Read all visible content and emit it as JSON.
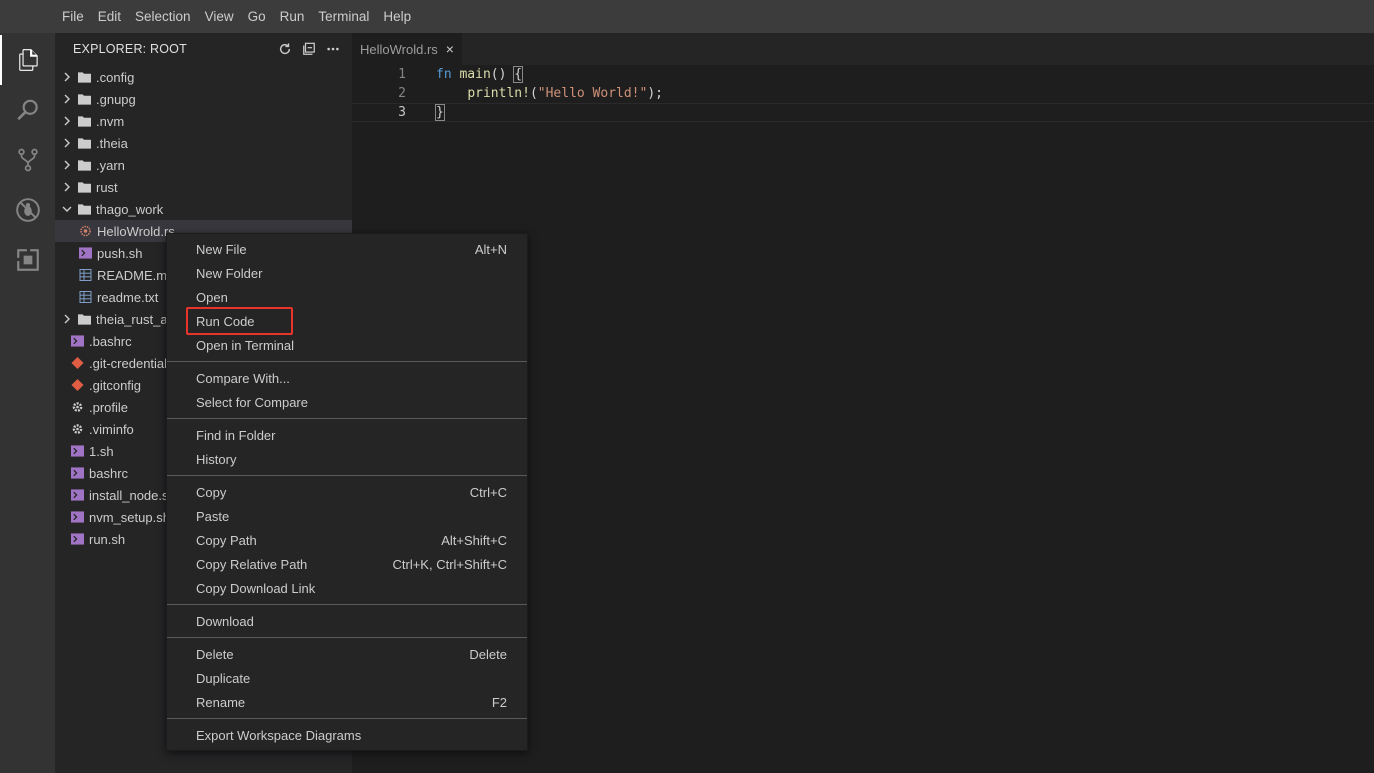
{
  "menubar": {
    "items": [
      "File",
      "Edit",
      "Selection",
      "View",
      "Go",
      "Run",
      "Terminal",
      "Help"
    ]
  },
  "activitybar": {
    "items": [
      {
        "icon": "files-icon",
        "active": true
      },
      {
        "icon": "search-icon",
        "active": false
      },
      {
        "icon": "source-control-icon",
        "active": false
      },
      {
        "icon": "debug-icon",
        "active": false
      },
      {
        "icon": "extensions-icon",
        "active": false
      }
    ]
  },
  "explorer": {
    "title": "EXPLORER: ROOT",
    "tools": [
      "refresh-icon",
      "collapse-all-icon",
      "more-icon"
    ],
    "tree": [
      {
        "name": ".config",
        "type": "folder",
        "expanded": false,
        "indent": 0
      },
      {
        "name": ".gnupg",
        "type": "folder",
        "expanded": false,
        "indent": 0
      },
      {
        "name": ".nvm",
        "type": "folder",
        "expanded": false,
        "indent": 0
      },
      {
        "name": ".theia",
        "type": "folder",
        "expanded": false,
        "indent": 0
      },
      {
        "name": ".yarn",
        "type": "folder",
        "expanded": false,
        "indent": 0
      },
      {
        "name": "rust",
        "type": "folder",
        "expanded": false,
        "indent": 0
      },
      {
        "name": "thago_work",
        "type": "folder",
        "expanded": true,
        "indent": 0
      },
      {
        "name": "HelloWrold.rs",
        "type": "rust",
        "indent": 1,
        "selected": true
      },
      {
        "name": "push.sh",
        "type": "shell",
        "indent": 1
      },
      {
        "name": "README.m",
        "type": "table",
        "indent": 1
      },
      {
        "name": "readme.txt",
        "type": "table",
        "indent": 1
      },
      {
        "name": "theia_rust_ap",
        "type": "folder",
        "expanded": false,
        "indent": 0
      },
      {
        "name": ".bashrc",
        "type": "shell",
        "indent": 0
      },
      {
        "name": ".git-credential",
        "type": "git",
        "indent": 0
      },
      {
        "name": ".gitconfig",
        "type": "git",
        "indent": 0
      },
      {
        "name": ".profile",
        "type": "gear",
        "indent": 0
      },
      {
        "name": ".viminfo",
        "type": "gear",
        "indent": 0
      },
      {
        "name": "1.sh",
        "type": "shell",
        "indent": 0
      },
      {
        "name": "bashrc",
        "type": "shell",
        "indent": 0
      },
      {
        "name": "install_node.s",
        "type": "shell",
        "indent": 0
      },
      {
        "name": "nvm_setup.sh",
        "type": "shell",
        "indent": 0
      },
      {
        "name": "run.sh",
        "type": "shell",
        "indent": 0
      }
    ]
  },
  "editor": {
    "tab": {
      "label": "HelloWrold.rs",
      "close": "×"
    },
    "lines": [
      {
        "num": "1"
      },
      {
        "num": "2"
      },
      {
        "num": "3"
      }
    ],
    "code": {
      "l1_kw": "fn",
      "l1_fn": "main",
      "l1_rest": "() ",
      "l1_brace": "{",
      "l2_indent": "    ",
      "l2_macro": "println!",
      "l2_open": "(",
      "l2_str": "\"Hello World!\"",
      "l2_close": ");",
      "l3_brace": "}"
    }
  },
  "context_menu": {
    "groups": [
      [
        {
          "label": "New File",
          "key": "Alt+N"
        },
        {
          "label": "New Folder",
          "key": ""
        },
        {
          "label": "Open",
          "key": ""
        },
        {
          "label": "Run Code",
          "key": "",
          "highlighted": true
        },
        {
          "label": "Open in Terminal",
          "key": ""
        }
      ],
      [
        {
          "label": "Compare With...",
          "key": ""
        },
        {
          "label": "Select for Compare",
          "key": ""
        }
      ],
      [
        {
          "label": "Find in Folder",
          "key": ""
        },
        {
          "label": "History",
          "key": ""
        }
      ],
      [
        {
          "label": "Copy",
          "key": "Ctrl+C"
        },
        {
          "label": "Paste",
          "key": ""
        },
        {
          "label": "Copy Path",
          "key": "Alt+Shift+C"
        },
        {
          "label": "Copy Relative Path",
          "key": "Ctrl+K, Ctrl+Shift+C"
        },
        {
          "label": "Copy Download Link",
          "key": ""
        }
      ],
      [
        {
          "label": "Download",
          "key": ""
        }
      ],
      [
        {
          "label": "Delete",
          "key": "Delete"
        },
        {
          "label": "Duplicate",
          "key": ""
        },
        {
          "label": "Rename",
          "key": "F2"
        }
      ],
      [
        {
          "label": "Export Workspace Diagrams",
          "key": ""
        }
      ]
    ]
  },
  "colors": {
    "highlight_box": "#e8352b",
    "shell_icon": "#a074c4",
    "git_icon": "#e05d44",
    "folder_icon": "#cccccc",
    "rust_icon": "#d0816b",
    "table_icon": "#7f9fc8"
  }
}
